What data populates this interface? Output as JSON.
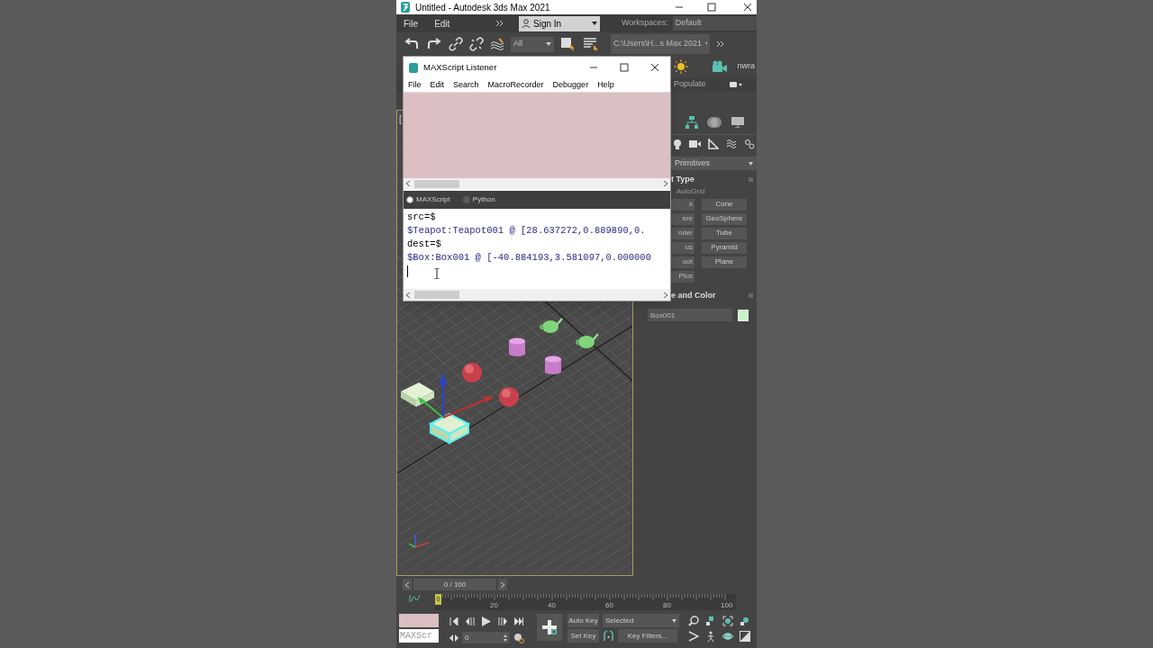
{
  "window": {
    "title": "Untitled - Autodesk 3ds Max 2021"
  },
  "menu_bar": {
    "items": [
      "File",
      "Edit"
    ],
    "sign_in": "Sign In",
    "workspaces_label": "Workspaces:",
    "workspace": "Default"
  },
  "toolbar": {
    "selection_filter": "All",
    "project_folder": "C:\\Users\\H...s Max 2021",
    "cut_label": "nwra"
  },
  "ribbon": {
    "populate": "Populate"
  },
  "viewport": {
    "label": "["
  },
  "command_panel": {
    "category": "Primitives",
    "object_type": {
      "title": "t Type",
      "autogrid": "AutoGrid",
      "buttons": [
        "x",
        "Cone",
        "ere",
        "GeoSphere",
        "nder",
        "Tube",
        "us",
        "Pyramid",
        "oot",
        "Plane",
        "Plus"
      ]
    },
    "name_and_color": {
      "title": "e and Color",
      "name": "Box001",
      "color": "#c6f5c6"
    }
  },
  "listener": {
    "title": "MAXScript Listener",
    "menu": [
      "File",
      "Edit",
      "Search",
      "MacroRecorder",
      "Debugger",
      "Help"
    ],
    "languages": [
      {
        "label": "MAXScript",
        "selected": true
      },
      {
        "label": "Python",
        "selected": false
      }
    ],
    "lines": [
      {
        "kind": "input",
        "text": "src=$"
      },
      {
        "kind": "output",
        "text": "$Teapot:Teapot001 @ [28.637272,0.889890,0."
      },
      {
        "kind": "input",
        "text": "dest=$"
      },
      {
        "kind": "output",
        "text": "$Box:Box001 @ [-40.884193,3.581097,0.000000"
      }
    ]
  },
  "time_slider": {
    "frame": "0 / 100",
    "level": 0,
    "current": "0",
    "ticks": [
      "20",
      "40",
      "60",
      "80",
      "100"
    ]
  },
  "controls": {
    "mini_listener": "MAXScr",
    "frame_field": "0",
    "auto_key": "Auto Key",
    "key_set": "Selected",
    "set_key": "Set Key",
    "key_filters": "Key Filters..."
  }
}
